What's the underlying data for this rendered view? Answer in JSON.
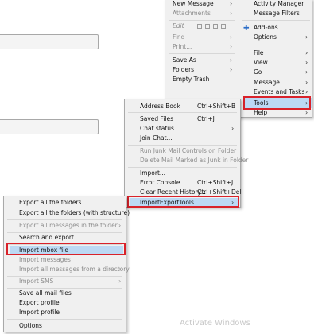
{
  "main_menu": {
    "col1": [
      "New Message",
      "Attachments",
      "Edit",
      "Find",
      "Print...",
      "Save As",
      "Folders",
      "Empty Trash"
    ],
    "col2": [
      "Activity Manager",
      "Message Filters",
      "Add-ons",
      "Options",
      "File",
      "View",
      "Go",
      "Message",
      "Events and Tasks",
      "Tools",
      "Help"
    ]
  },
  "tools_menu": {
    "items": [
      "Address Book",
      "Saved Files",
      "Chat status",
      "Join Chat...",
      "Run Junk Mail Controls on Folder",
      "Delete Mail Marked as Junk in Folder",
      "Import...",
      "Error Console",
      "Clear Recent History...",
      "ImportExportTools"
    ],
    "shortcuts": [
      "Ctrl+Shift+B",
      "Ctrl+J",
      "Ctrl+Shift+J",
      "Ctrl+Shift+Del"
    ]
  },
  "import_export_menu": {
    "items": [
      "Export all the folders",
      "Export all the folders (with structure)",
      "Export all messages in the folder",
      "Search and export",
      "Import mbox file",
      "Import messages",
      "Import all messages from a directory",
      "Import SMS",
      "Save all mail files",
      "Export profile",
      "Import profile",
      "Options"
    ]
  },
  "watermark": "Activate Windows"
}
